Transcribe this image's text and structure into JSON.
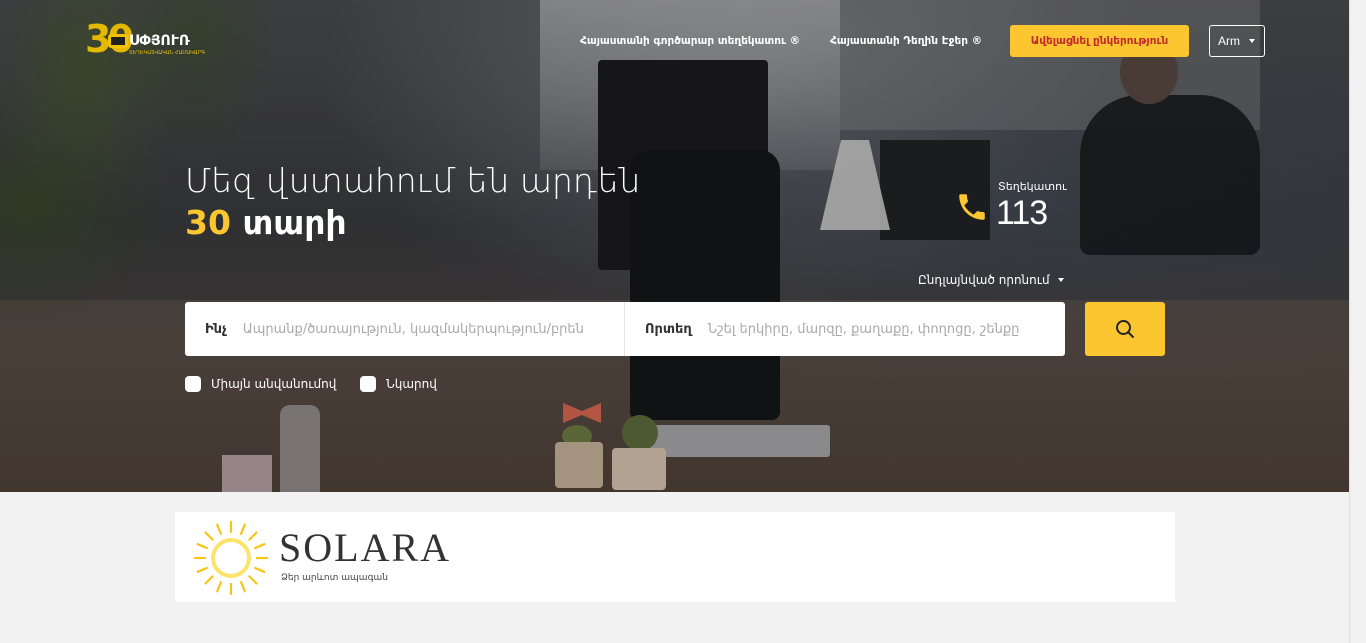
{
  "header": {
    "logo_number": "30",
    "logo_word": "ՍՓՅՈՒՌ",
    "logo_tagline": "ՏԵՂԵԿԱՏՎԱԿԱՆ ՀԱՄԱԿԱՐԳ",
    "nav": [
      {
        "label": "Հայաստանի գործարար տեղեկատու ®"
      },
      {
        "label": "Հայաստանի Դեղին Էջեր ®"
      }
    ],
    "cta_label": "Ավելացնել ընկերություն",
    "language": "Arm"
  },
  "hero": {
    "headline_line1": "Մեզ վստահում են արդեն",
    "headline_years": "30",
    "headline_word": "տարի",
    "phone_label": "Տեղեկատու",
    "phone_number": "113",
    "advanced_search_label": "Ընդլայնված որոնում"
  },
  "search": {
    "what_label": "Ինչ",
    "what_placeholder": "Ապրանք/ծառայություն, կազմակերպություն/բրեն",
    "where_label": "Որտեղ",
    "where_placeholder": "Նշել երկիրը, մարզը, քաղաքը, փողոցը, շենքը"
  },
  "filters": [
    {
      "label": "Միայն անվանումով",
      "checked": false
    },
    {
      "label": "Նկարով",
      "checked": false
    }
  ],
  "banner": {
    "brand": "SOLARA",
    "slogan": "Ձեր արևոտ ապագան"
  },
  "colors": {
    "accent": "#fcc630",
    "cta_text": "#c2282f"
  }
}
